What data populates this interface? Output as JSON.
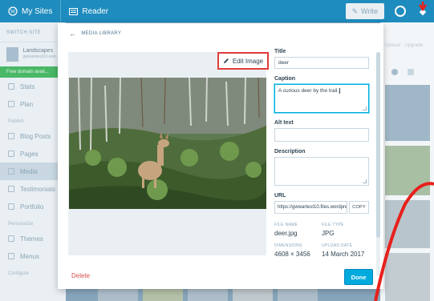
{
  "masterbar": {
    "my_sites": "My Sites",
    "reader": "Reader",
    "write": "Write"
  },
  "sidebar": {
    "switch_site": "SWITCH SITE",
    "site_name": "Landscapes",
    "site_url": "gwwartest10.wor...",
    "plan_notice": "Free domain avail...",
    "items_top": [
      "Stats",
      "Plan"
    ],
    "section_label": "Publish",
    "items_publish": [
      "Blog Posts",
      "Pages",
      "Media",
      "Testimonials",
      "Portfolio"
    ],
    "personalize_label": "Personalize",
    "items_personalize": [
      "Themes",
      "Menus"
    ],
    "configure_label": "Configure"
  },
  "right_panel": {
    "links": "Upload · Upgrade"
  },
  "modal": {
    "breadcrumb": "MEDIA LIBRARY",
    "edit_image_label": "Edit Image",
    "title_label": "Title",
    "title_value": "deer",
    "caption_label": "Caption",
    "caption_value": "A curious deer by the trail.",
    "alt_label": "Alt text",
    "alt_value": "",
    "description_label": "Description",
    "description_value": "",
    "url_label": "URL",
    "url_value": "https://gwwartest10.files.wordpress.com/2017/03/deer.jpg",
    "copy_label": "COPY",
    "file_name_label": "FILE NAME",
    "file_name_value": "deer.jpg",
    "file_type_label": "FILE TYPE",
    "file_type_value": "JPG",
    "dimensions_label": "DIMENSIONS",
    "dimensions_value": "4608 × 3456",
    "upload_date_label": "UPLOAD DATE",
    "upload_date_value": "14 March 2017",
    "delete_label": "Delete",
    "done_label": "Done"
  },
  "colors": {
    "accent": "#00aadc",
    "masterbar": "#1e8cbe",
    "highlight_box": "#e03a3a",
    "annotation_stroke": "#e8201c",
    "delete": "#d94f4f"
  },
  "icons": [
    "wordpress-icon",
    "reader-icon",
    "write-icon",
    "notifications-icon",
    "avatar-icon",
    "pencil-icon",
    "back-arrow-icon"
  ]
}
